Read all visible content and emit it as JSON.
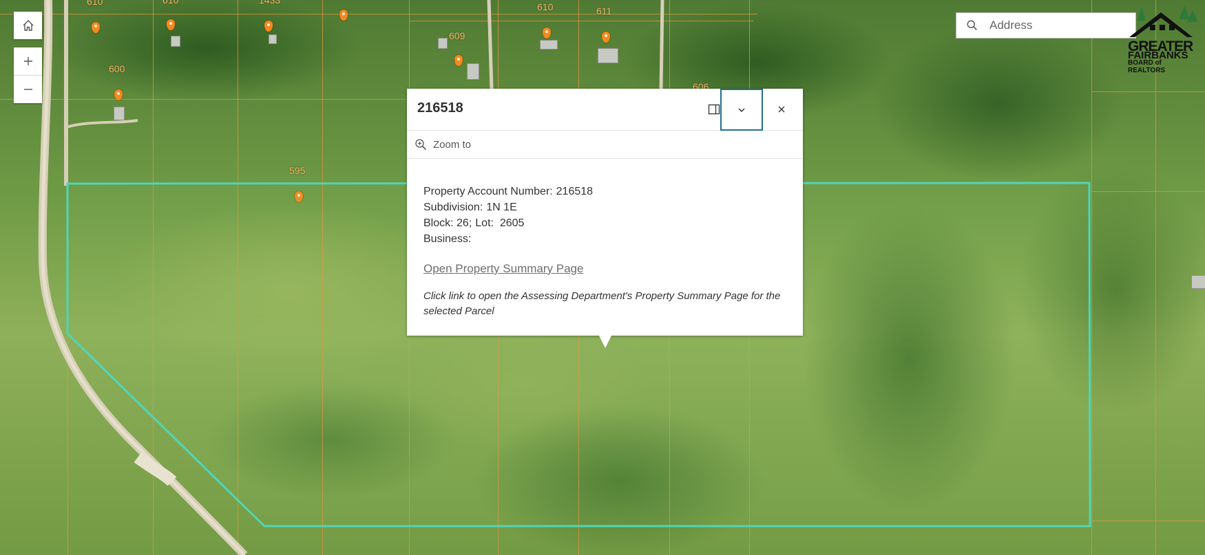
{
  "map": {
    "parcel_labels": [
      "610",
      "610",
      "1433",
      "610",
      "611",
      "609",
      "600",
      "595",
      "606"
    ],
    "highlight_color": "#4fd6b8",
    "parcel_line_color": "#e8963c",
    "pin_color": "#f28a1e"
  },
  "controls": {
    "home_icon": "home-icon",
    "zoom_in_icon": "plus-icon",
    "zoom_out_icon": "minus-icon"
  },
  "search": {
    "placeholder": "Address",
    "icon": "search-icon"
  },
  "logo": {
    "line1": "GREATER",
    "line2": "FAIRBANKS",
    "line3": "BOARD of REALTORS"
  },
  "popup": {
    "title": "216518",
    "zoom_to_label": "Zoom to",
    "fields": [
      {
        "label": "Property Account Number:",
        "value": "216518"
      },
      {
        "label": "Subdivision:",
        "value": "1N 1E"
      },
      {
        "label": "Block: 26;",
        "value": "Lot:  2605"
      },
      {
        "label": "Business:",
        "value": ""
      }
    ],
    "link_text": "Open Property Summary Page",
    "note": "Click link to open the Assessing Department's Property Summary Page for the selected Parcel"
  }
}
